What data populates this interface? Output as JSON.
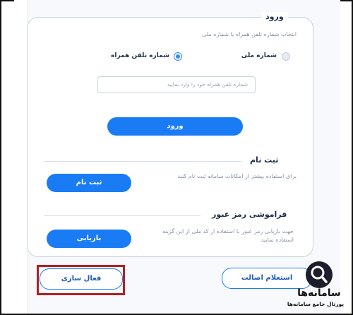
{
  "login": {
    "legend": "ورود",
    "hint": "انتخاب شماره تلفن همراه یا شماره ملی",
    "radio_national": "شماره ملی",
    "radio_mobile": "شماره تلفن همراه",
    "selected": "mobile",
    "input_placeholder": "شماره تلفن همراه خود را وارد نمایید",
    "submit_label": "ورود"
  },
  "register": {
    "legend": "ثبت نام",
    "hint": "برای استفاده بیشتر از امکانات سامانه ثبت نام کنید",
    "button_label": "ثبت نام"
  },
  "forgot": {
    "legend": "فراموشی رمز عبور",
    "hint": "جهت بازیابی رمز عبور با استفاده از کد ملی از این گزینه استفاده نمایید",
    "button_label": "بازیابی"
  },
  "bottom": {
    "activate_label": "فعال سازی",
    "authenticity_label": "استعلام اصالت"
  },
  "watermark": {
    "brand": "سامانه‌ها",
    "tagline": "پورتال جامع سامانه‌ها"
  },
  "colors": {
    "primary": "#1a7cf5",
    "highlight": "#b21f24"
  }
}
